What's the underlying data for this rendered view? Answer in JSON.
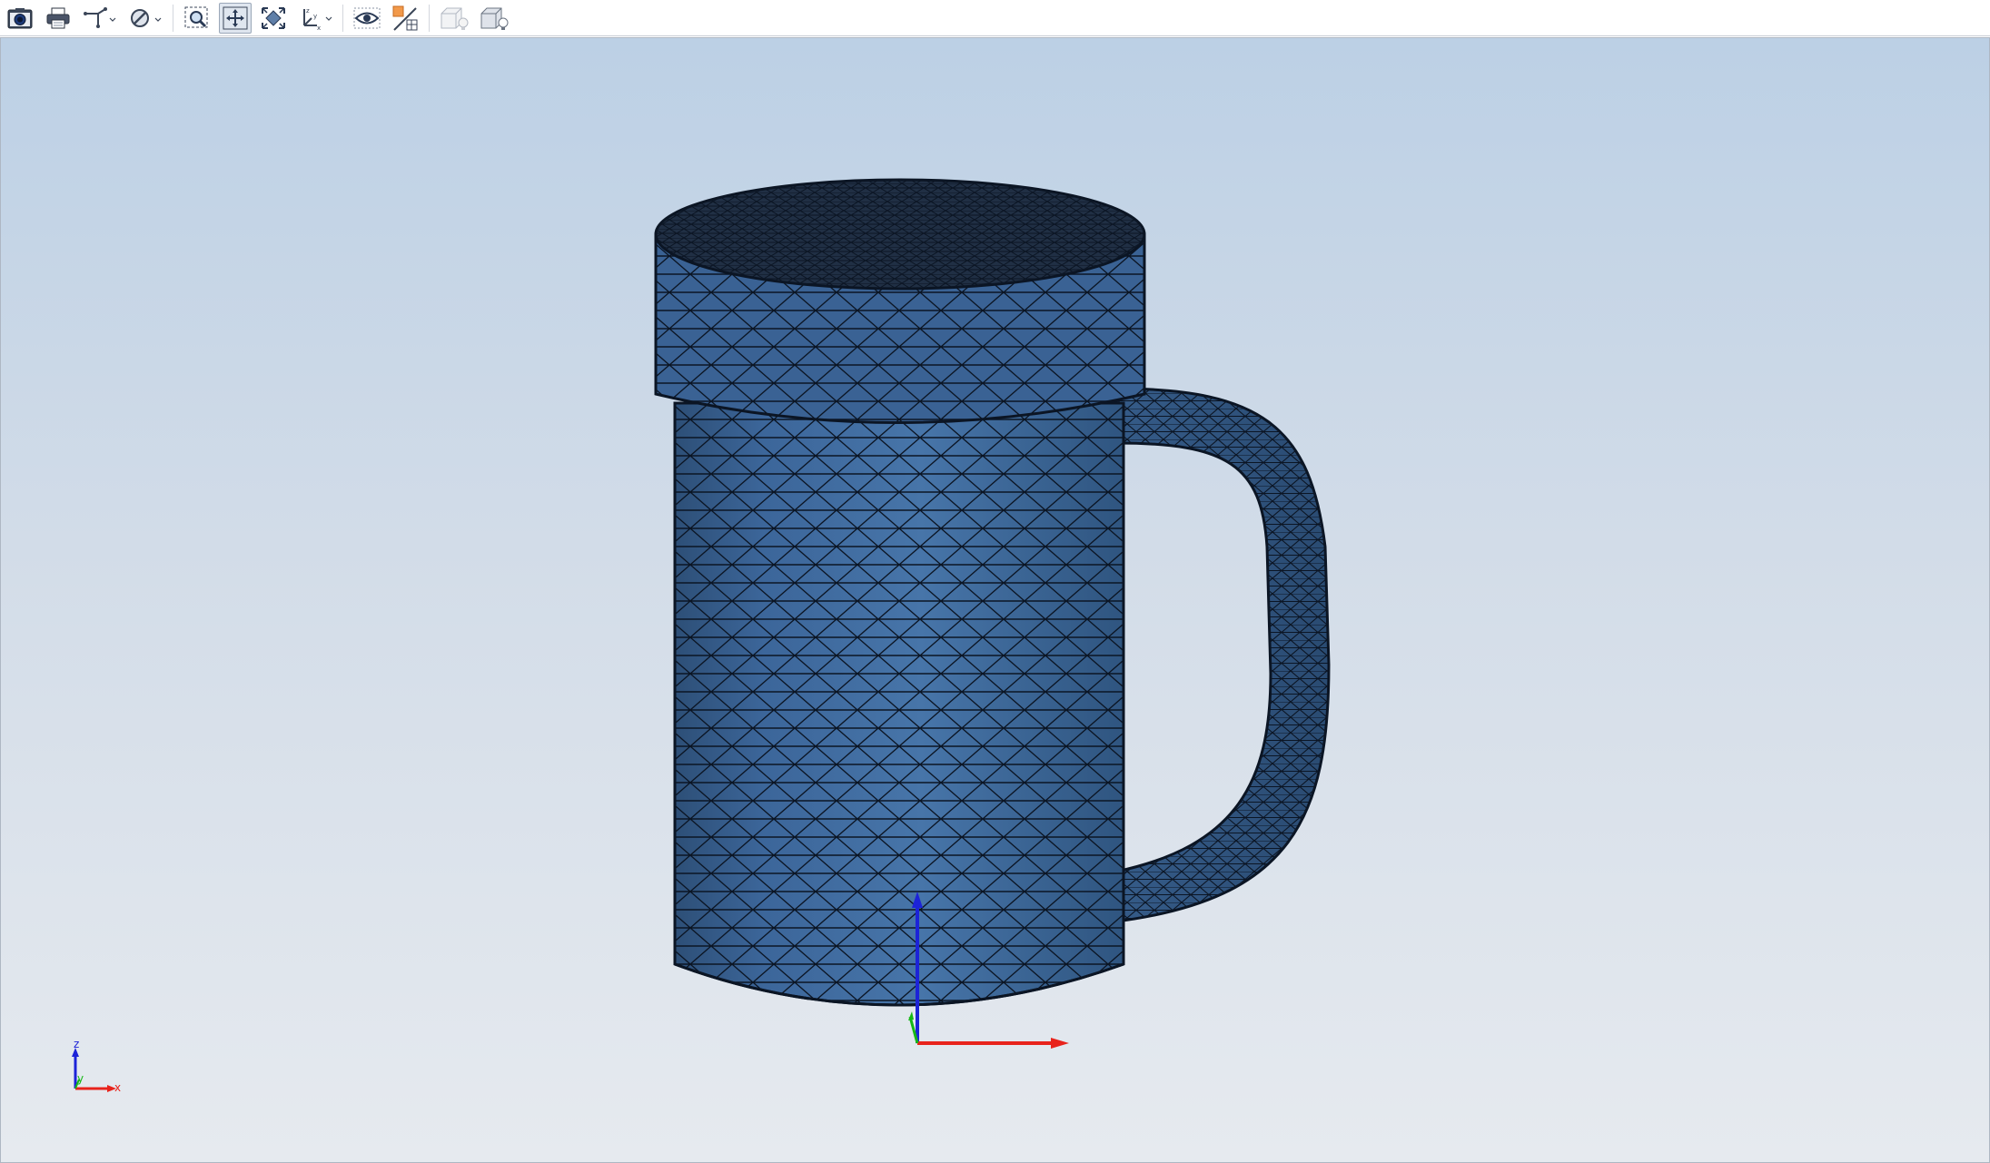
{
  "toolbar": {
    "buttons": [
      {
        "name": "screenshot-button",
        "icon": "camera-icon"
      },
      {
        "name": "print-button",
        "icon": "printer-icon"
      },
      {
        "name": "triad-toggle-button",
        "icon": "axis-triad-icon",
        "has_dropdown": true
      },
      {
        "name": "display-mode-button",
        "icon": "section-icon",
        "has_dropdown": true
      },
      {
        "name": "zoom-window-button",
        "icon": "zoom-box-icon"
      },
      {
        "name": "pan-button",
        "icon": "pan-arrows-icon",
        "active": true
      },
      {
        "name": "fit-view-button",
        "icon": "fit-all-icon"
      },
      {
        "name": "view-orientation-button",
        "icon": "xyz-orientation-icon",
        "has_dropdown": true
      },
      {
        "name": "visibility-button",
        "icon": "eye-icon"
      },
      {
        "name": "color-map-button",
        "icon": "color-split-icon"
      },
      {
        "name": "shaded-light-button",
        "icon": "box-lightbulb-icon",
        "disabled": true
      },
      {
        "name": "lighting-button",
        "icon": "box-lightbulb-icon"
      }
    ]
  },
  "viewport": {
    "background_top": "#bcd0e5",
    "background_bottom": "#e6eaef",
    "model": {
      "name": "mug-mesh",
      "fill_color": "#3f6a9b",
      "edge_color": "#0b1524"
    },
    "origin_triad": {
      "x_color": "#e8231c",
      "y_color": "#16b816",
      "z_color": "#1c23d8"
    },
    "orientation_triad": {
      "x_label": "x",
      "y_label": "y",
      "z_label": "z"
    }
  }
}
